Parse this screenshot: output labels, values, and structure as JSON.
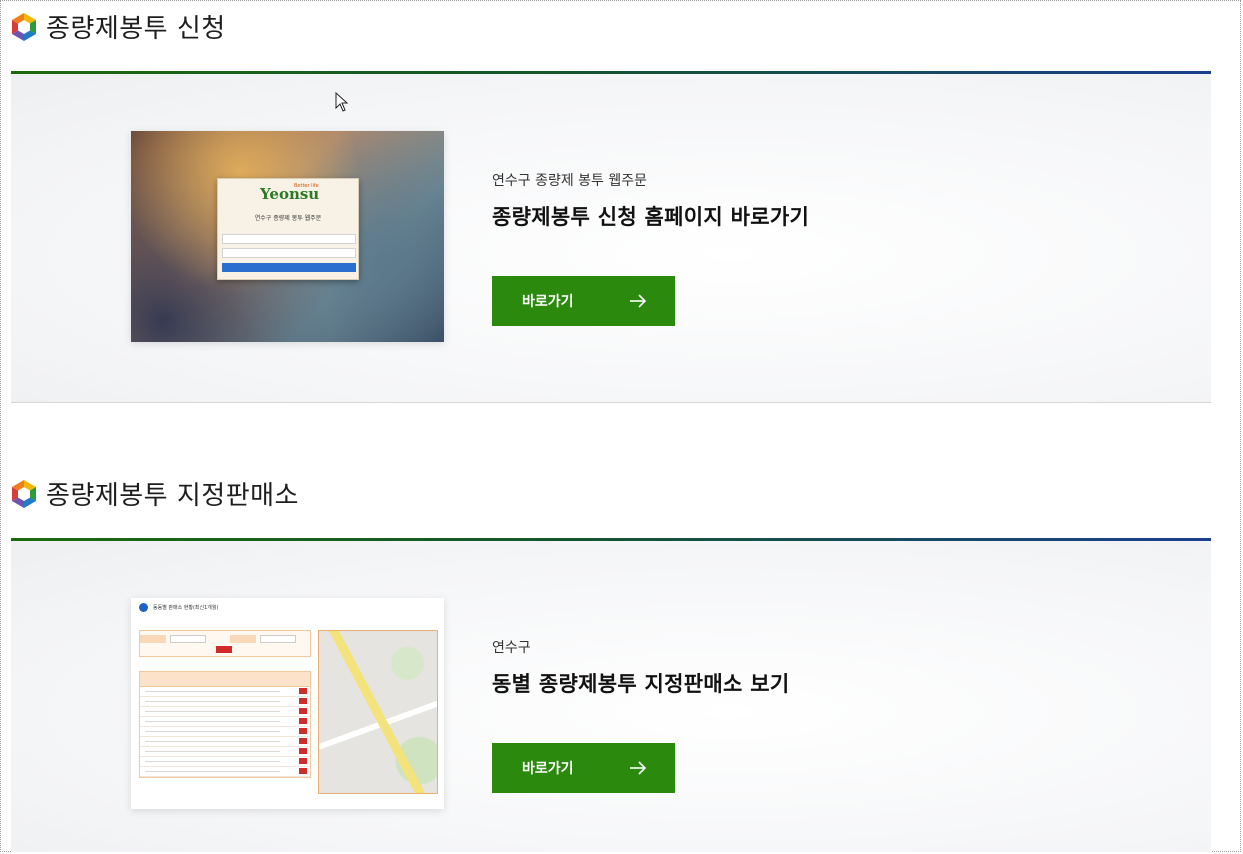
{
  "sections": [
    {
      "title": "종량제봉투 신청",
      "subtitle": "연수구 종량제 봉투 웹주문",
      "heading": "종량제봉투 신청 홈페이지 바로가기",
      "button_label": "바로가기",
      "preview": {
        "brand": "Yeonsu",
        "brand_tag": "Better life",
        "title": "연수구 종량제 봉투 웹주문"
      }
    },
    {
      "title": "종량제봉투 지정판매소",
      "subtitle": "연수구",
      "heading": "동별 종량제봉투 지정판매소 보기",
      "button_label": "바로가기",
      "preview": {
        "title": "동동별 판매소 현황(최신1개월)"
      }
    }
  ],
  "colors": {
    "accent_green": "#2b8a0e",
    "rule_start": "#1c6a0e",
    "rule_end": "#1a3f8f"
  },
  "icons": [
    "hexagon-logo-icon",
    "arrow-right-icon",
    "mouse-cursor-icon"
  ]
}
